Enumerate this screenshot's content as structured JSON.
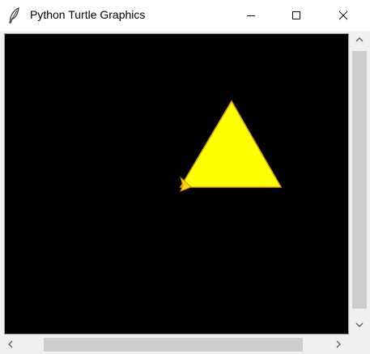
{
  "window": {
    "title": "Python Turtle Graphics",
    "icon": "feather-icon",
    "controls": [
      "minimize-icon",
      "maximize-icon",
      "close-icon"
    ]
  },
  "canvas": {
    "background": "#000000",
    "shape": {
      "type": "triangle",
      "fill": "#ffff00",
      "outline": "#d4a017"
    },
    "turtle": {
      "icon": "turtle-arrow-icon",
      "fill": "#ffd700",
      "outline": "#cc8800"
    }
  },
  "scrollbars": {
    "vertical": {
      "up_icon": "chevron-up-icon",
      "down_icon": "chevron-down-icon"
    },
    "horizontal": {
      "left_icon": "chevron-left-icon",
      "right_icon": "chevron-right-icon"
    }
  }
}
